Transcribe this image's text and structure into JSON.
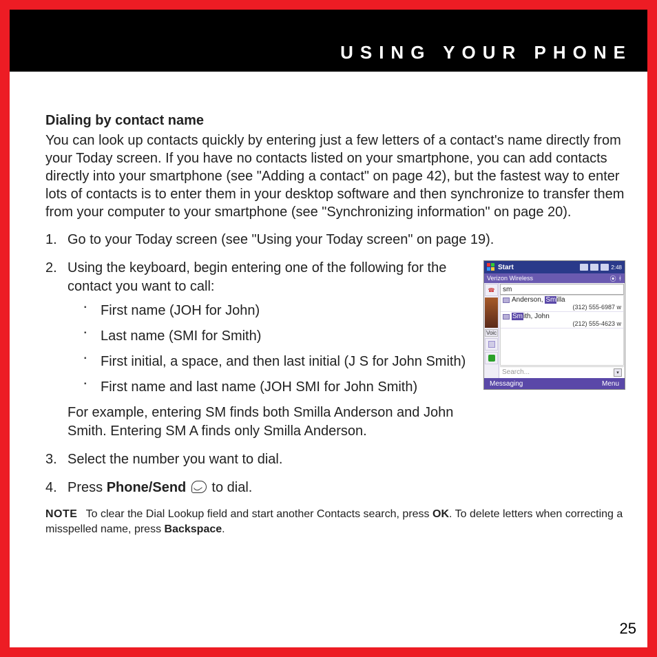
{
  "banner": {
    "title": "USING YOUR PHONE"
  },
  "section": {
    "title": "Dialing by contact name",
    "intro": "You can look up contacts quickly by entering just a few letters of a contact's name directly from your Today screen. If you have no contacts listed on your smartphone, you can add contacts directly into your smartphone (see \"Adding a contact\" on page 42), but the fastest way to enter lots of contacts is to enter them in your desktop software and then synchronize to transfer them from your computer to your smartphone (see \"Synchronizing information\" on page 20).",
    "steps": {
      "s1": "Go to your Today screen (see \"Using your Today screen\" on page 19).",
      "s2": "Using the keyboard, begin entering one of the following for the contact you want to call:",
      "s2_bullets": {
        "b1": "First name (JOH for John)",
        "b2": "Last name (SMI for Smith)",
        "b3": "First initial, a space, and then last initial (J S for John Smith)",
        "b4": "First name and last name (JOH SMI for John Smith)"
      },
      "s2_example": "For example, entering SM finds both Smilla Anderson and John Smith. Entering SM A finds only Smilla Anderson.",
      "s3": "Select the number you want to dial.",
      "s4_pre": "Press ",
      "s4_bold": "Phone/Send",
      "s4_post": " to dial."
    },
    "note": {
      "label": "NOTE",
      "t1": "To clear the Dial Lookup field and start another Contacts search, press ",
      "b1": "OK",
      "t2": ". To delete letters when correcting a misspelled name, press ",
      "b2": "Backspace",
      "t3": "."
    }
  },
  "screenshot": {
    "start": "Start",
    "time": "2:48",
    "carrier": "Verizon Wireless",
    "input_value": "sm",
    "contacts": [
      {
        "prefix": "Anderson, ",
        "hl": "Sm",
        "suffix": "illa",
        "number": "(312) 555-6987 w"
      },
      {
        "prefix": "",
        "hl": "Sm",
        "suffix": "ith, John",
        "number": "(212) 555-4623 w"
      }
    ],
    "side_label": "Voic",
    "search_placeholder": "Search...",
    "softkeys": {
      "left": "Messaging",
      "right": "Menu"
    }
  },
  "page_number": "25"
}
